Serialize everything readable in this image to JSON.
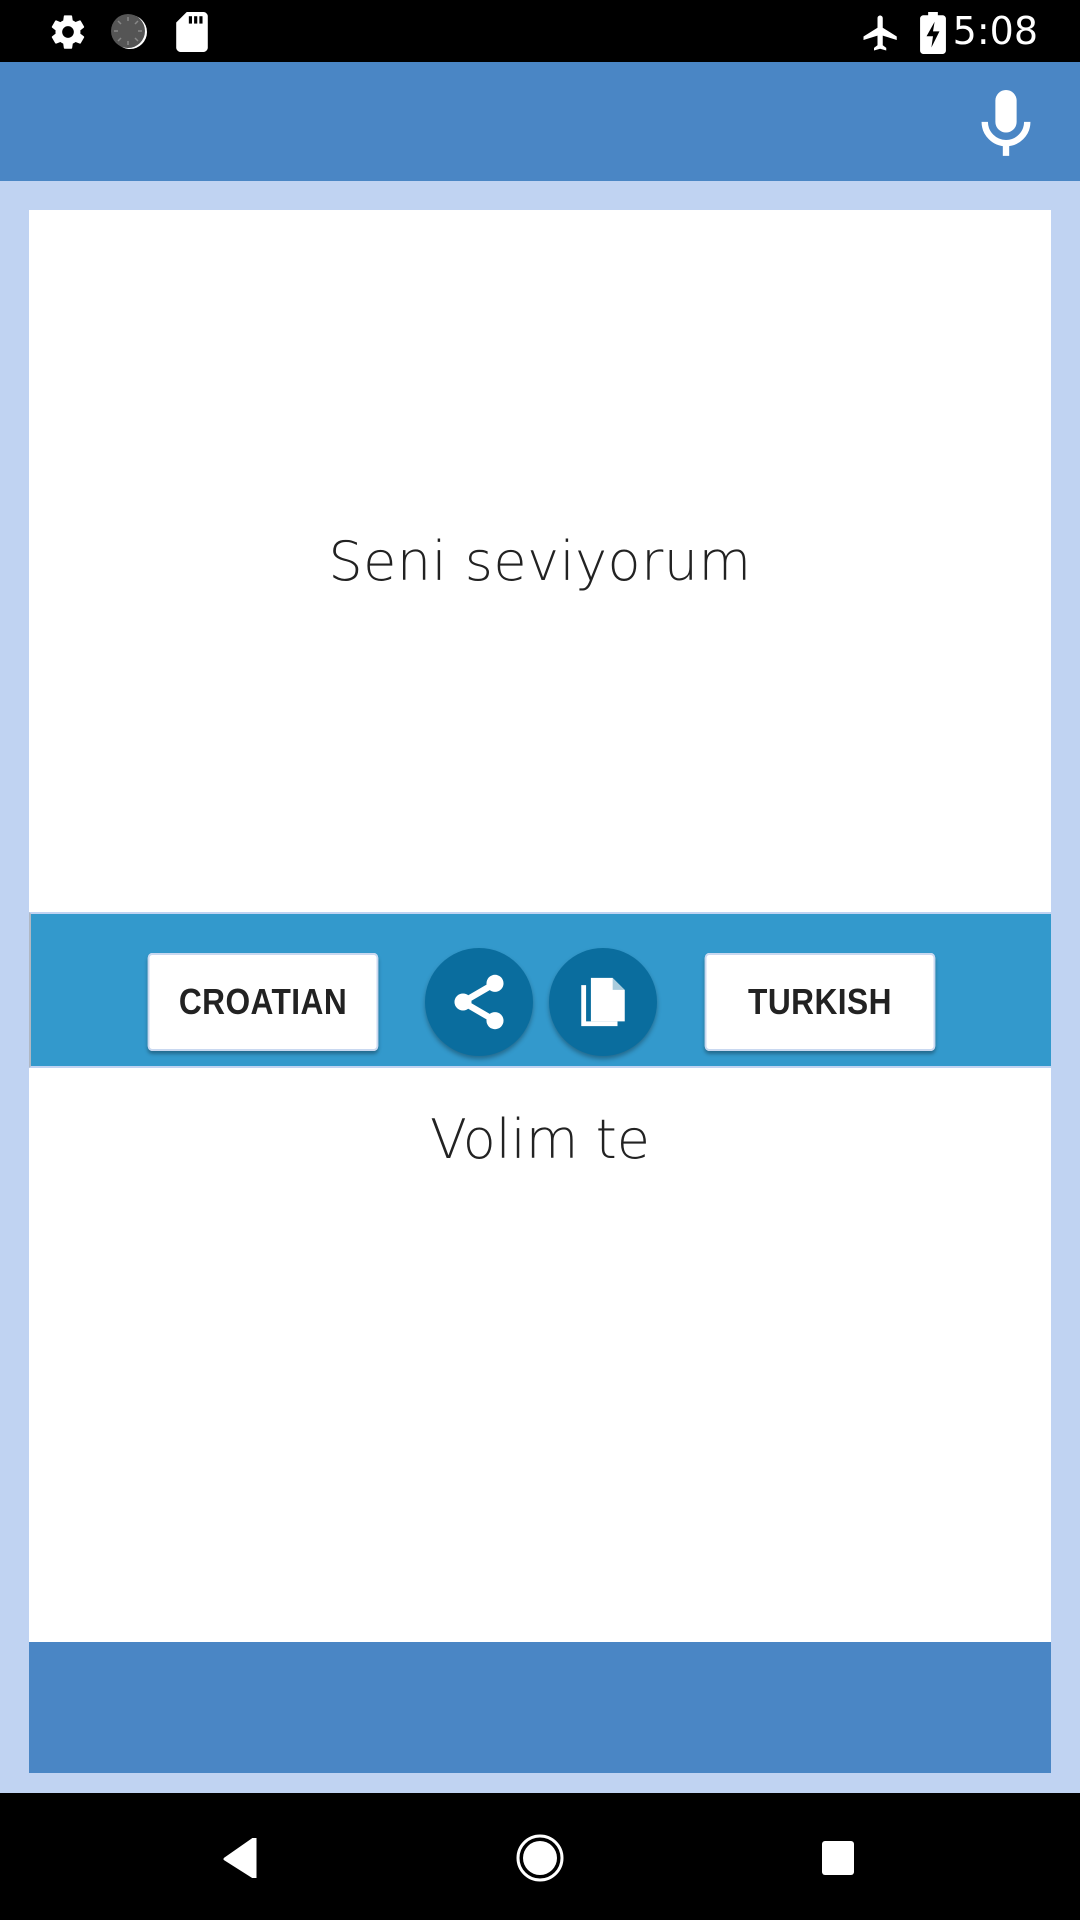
{
  "status_bar": {
    "left_icons": [
      "gear-icon",
      "sync-circle-icon",
      "sd-card-icon"
    ],
    "right_icons": [
      "airplane-mode-icon",
      "battery-charging-icon"
    ],
    "time": "5:08"
  },
  "app_bar": {
    "action_icon": "microphone-icon"
  },
  "source": {
    "text": "Seni seviyorum"
  },
  "toolbar": {
    "source_language": "CROATIAN",
    "target_language": "TURKISH",
    "share_icon": "share-icon",
    "copy_icon": "copy-icon"
  },
  "output": {
    "text": "Volim te"
  },
  "nav_bar": {
    "buttons": [
      "back-icon",
      "home-icon",
      "recents-icon"
    ]
  },
  "colors": {
    "app_bar": "#4A86C5",
    "background": "#C0D3F2",
    "toolbar": "#3399CC",
    "circle_button": "#0A6D9E",
    "text": "#222222"
  }
}
